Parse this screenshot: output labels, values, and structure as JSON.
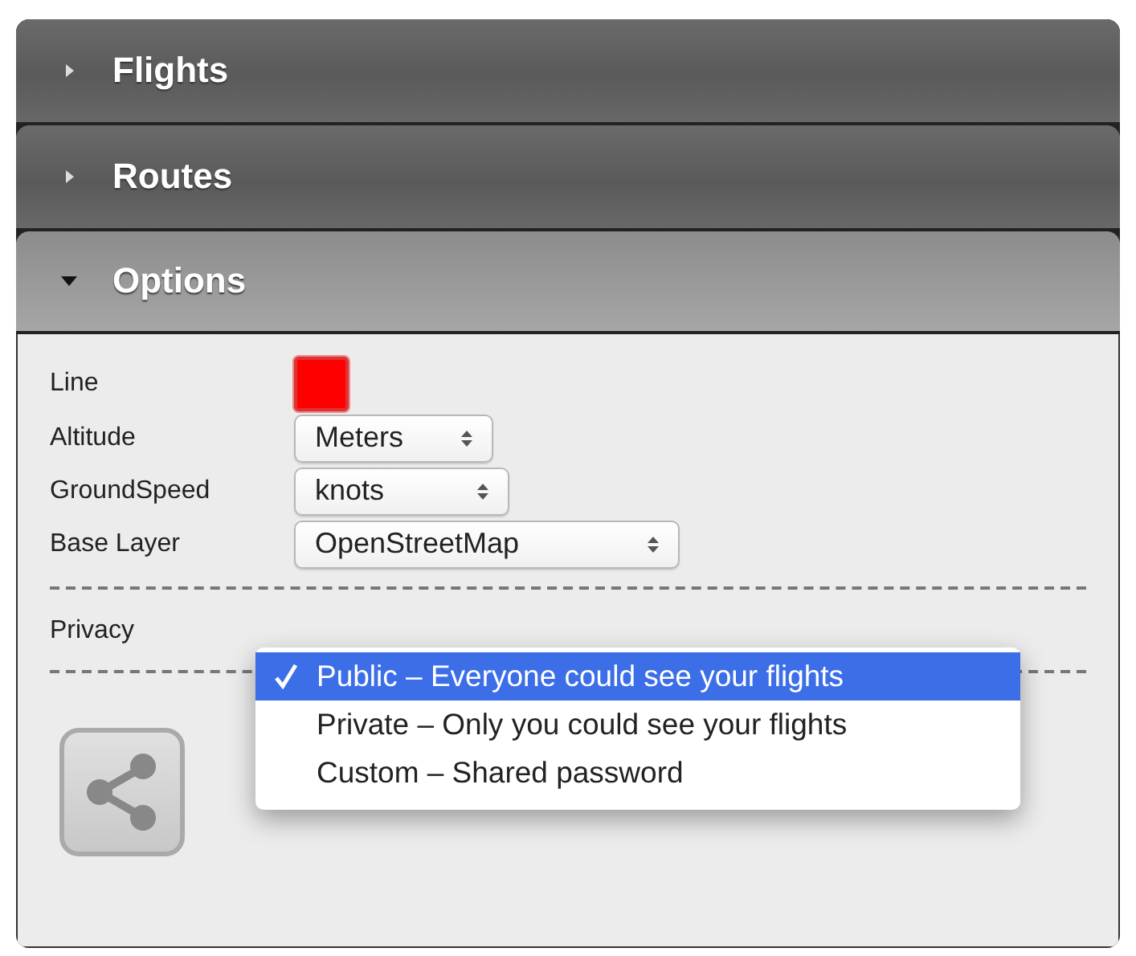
{
  "sections": [
    {
      "title": "Flights",
      "expanded": false
    },
    {
      "title": "Routes",
      "expanded": false
    },
    {
      "title": "Options",
      "expanded": true
    }
  ],
  "options": {
    "rows": [
      {
        "kind": "color",
        "label": "Line",
        "color": "#ff0000"
      },
      {
        "kind": "select",
        "label": "Altitude",
        "value": "Meters"
      },
      {
        "kind": "select",
        "label": "GroundSpeed",
        "value": "knots"
      },
      {
        "kind": "select",
        "label": "Base Layer",
        "value": "OpenStreetMap"
      }
    ],
    "privacy": {
      "label": "Privacy",
      "menu": [
        {
          "label": "Public – Everyone could see your flights",
          "selected": true
        },
        {
          "label": "Private – Only you could see your flights",
          "selected": false
        },
        {
          "label": "Custom – Shared password",
          "selected": false
        }
      ]
    }
  }
}
